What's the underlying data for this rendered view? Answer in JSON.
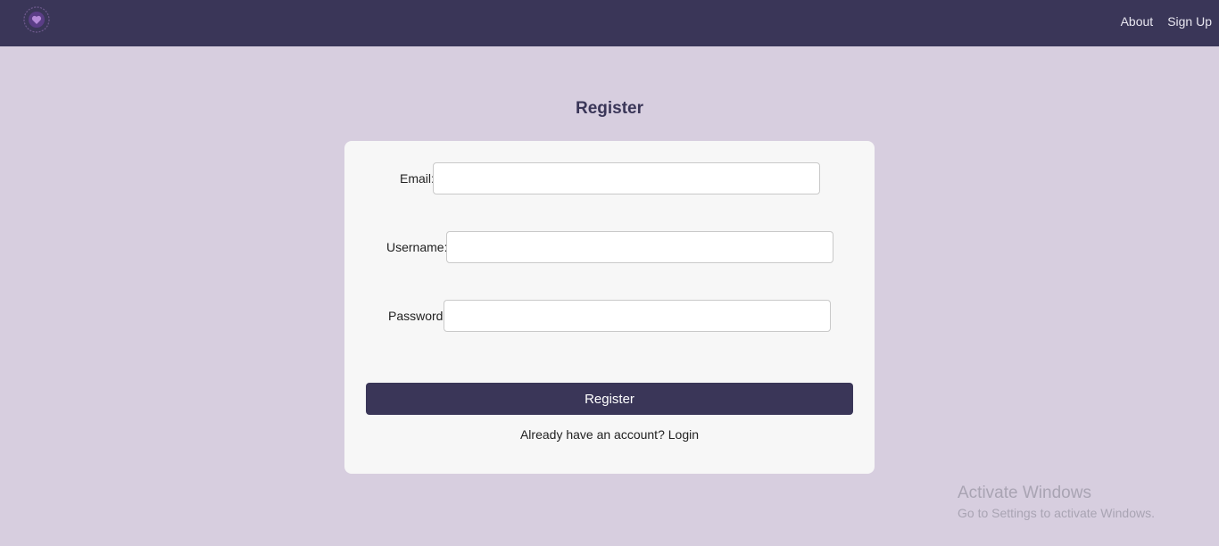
{
  "nav": {
    "logo_icon": "brand-logo-icon",
    "links": [
      {
        "label": "About"
      },
      {
        "label": "Sign Up"
      }
    ]
  },
  "page": {
    "title": "Register"
  },
  "form": {
    "email_label": "Email:",
    "email_value": "",
    "email_placeholder": "",
    "username_label": "Username:",
    "username_value": "",
    "username_placeholder": "",
    "password_label": "Password:",
    "password_value": "",
    "password_placeholder": "",
    "submit_label": "Register",
    "login_prompt": "Already have an account?",
    "login_link": "Login"
  },
  "watermark": {
    "title": "Activate Windows",
    "subtitle": "Go to Settings to activate Windows."
  },
  "colors": {
    "navbar": "#3a3658",
    "background": "#d7cedf",
    "card": "#f7f7f7",
    "button": "#3a3658"
  }
}
